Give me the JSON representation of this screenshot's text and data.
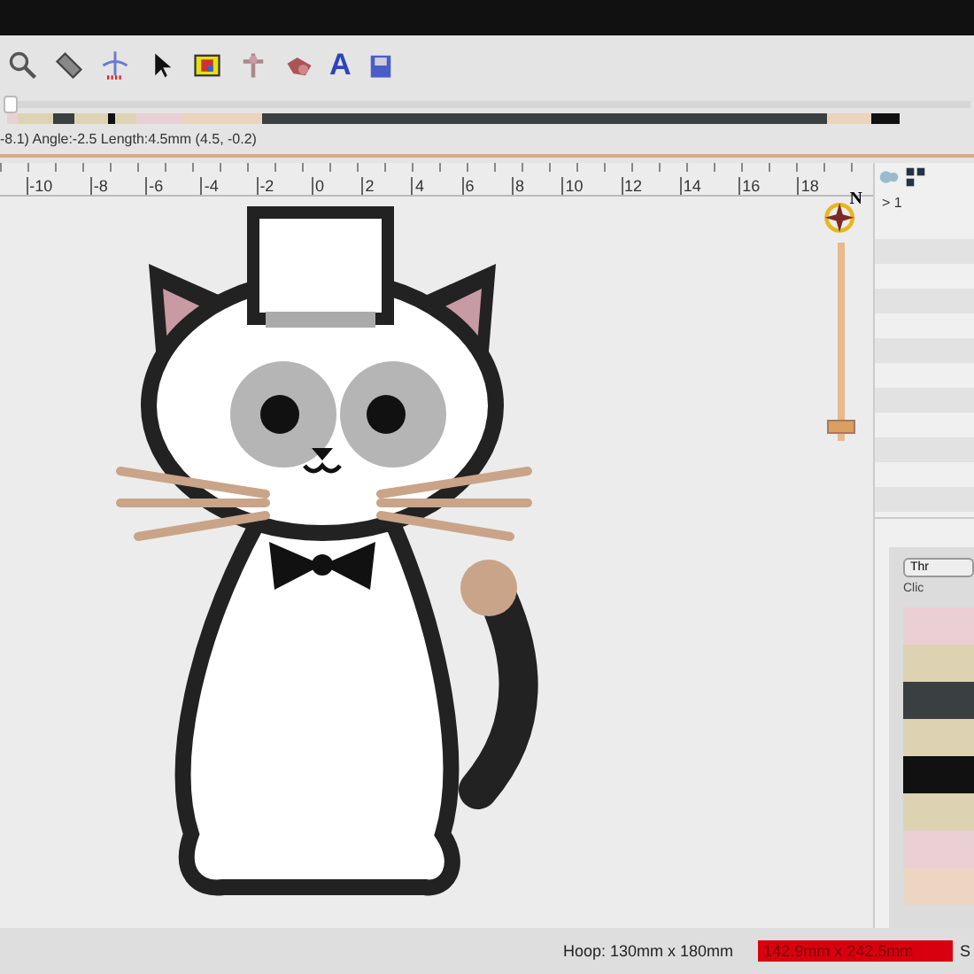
{
  "toolbar": {
    "text_icon": "A"
  },
  "stitch_slider": {
    "level": 0.0
  },
  "stitch_colors": [
    {
      "color": "#ead0d4"
    },
    {
      "color": "#ddd3b3"
    },
    {
      "color": "#3a3f41"
    },
    {
      "color": "#ddd3b3"
    },
    {
      "color": "#111111"
    },
    {
      "color": "#ddd3b3"
    },
    {
      "color": "#ead0d4"
    },
    {
      "color": "#ecd3bc"
    },
    {
      "color": "#3a3f41"
    },
    {
      "color": "#ecd3bc"
    },
    {
      "color": "#111111"
    }
  ],
  "stitch_info": "-8.1)  Angle:-2.5  Length:4.5mm  (4.5, -0.2)",
  "ruler": [
    "-10",
    "-8",
    "-6",
    "-4",
    "-2",
    "0",
    "2",
    "4",
    "6",
    "8",
    "10",
    "12",
    "14",
    "16",
    "18"
  ],
  "compass": {
    "label": "N"
  },
  "zoom_slider": {
    "level": 0.04
  },
  "objects_panel": {
    "item": "> 1"
  },
  "threads_panel": {
    "button": "Thr",
    "hint": "Clic",
    "swatches": [
      {
        "color": "#ead0d4"
      },
      {
        "color": "#ddd3b3"
      },
      {
        "color": "#3a3f41"
      },
      {
        "color": "#ddd3b3"
      },
      {
        "color": "#111111"
      },
      {
        "color": "#ddd3b3"
      },
      {
        "color": "#ead0d4"
      },
      {
        "color": "#ecd6c2"
      }
    ]
  },
  "status_bar": {
    "hoop": "Hoop: 130mm x 180mm",
    "design_size": "142.9mm x 242.5mm",
    "design_too_big": true,
    "cut_text": "S"
  }
}
